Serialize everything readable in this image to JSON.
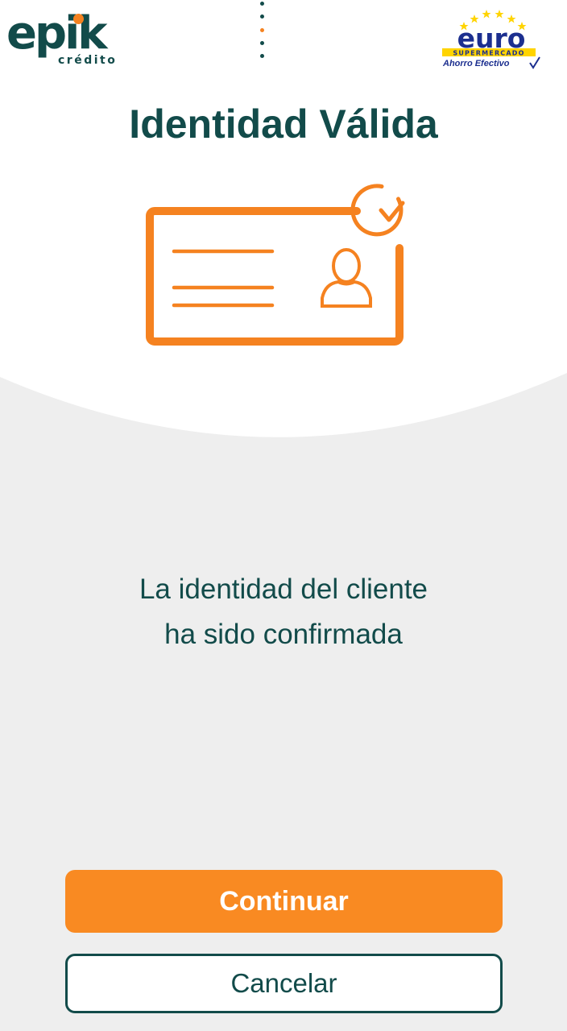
{
  "header": {
    "brand_left": {
      "wordmark": "epik",
      "sub": "crédito"
    },
    "brand_right": {
      "wordmark": "euro",
      "band": "SUPERMERCADO",
      "tagline": "Ahorro Efectivo"
    },
    "menu_icon": "vertical-dots-icon"
  },
  "main": {
    "title": "Identidad Válida",
    "illustration_icon": "id-card-verified-icon",
    "message_line1": "La identidad del cliente",
    "message_line2": "ha sido confirmada"
  },
  "actions": {
    "continue_label": "Continuar",
    "cancel_label": "Cancelar"
  },
  "colors": {
    "accent": "#f98a22",
    "primary_text": "#124b4a",
    "background": "#eeeeee",
    "euro_blue": "#1c2f8f",
    "euro_yellow": "#ffd400"
  }
}
